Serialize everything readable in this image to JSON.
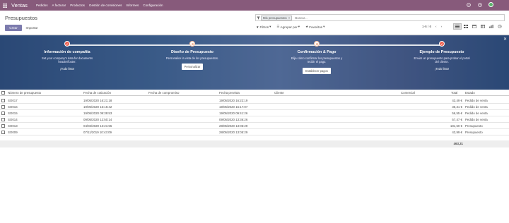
{
  "navbar": {
    "app_title": "Ventas",
    "menu": [
      "Pedidos",
      "A facturar",
      "Productos",
      "Gestión de comisiones",
      "Informes",
      "Configuración"
    ]
  },
  "control_panel": {
    "breadcrumb": "Presupuestos",
    "create_label": "Crear",
    "import_label": "Importar",
    "search_facet": "Mis presupuestos",
    "search_placeholder": "Buscar...",
    "filters_label": "Filtros",
    "group_label": "Agrupar por",
    "favorites_label": "Favoritos",
    "pager": "1-6 / 6"
  },
  "banner": {
    "steps": [
      {
        "title": "Información de compañía",
        "desc": "Set your company's data for documents header/footer.",
        "done": "¡Todo listo!",
        "button": "",
        "state": "done"
      },
      {
        "title": "Diseño de Presupuesto",
        "desc": "Personalice la vista de los presupuestos.",
        "done": "",
        "button": "Personalizar",
        "state": "todo"
      },
      {
        "title": "Confirmación & Pago",
        "desc": "Elija cómo confirmar los presupuestos y recibir el pago.",
        "done": "",
        "button": "Establecer pagos",
        "state": "todo"
      },
      {
        "title": "Ejemplo de Presupuesto",
        "desc": "Enviar un presupuesto para probar el portal del cliente.",
        "done": "¡Todo listo!",
        "button": "",
        "state": "done"
      }
    ]
  },
  "table": {
    "headers": {
      "number": "Número de presupuesto",
      "quote_date": "Fecha de cotización",
      "commit_date": "Fecha de compromiso",
      "expected_date": "Fecha prevista",
      "customer": "Cliente",
      "salesperson": "Comercial",
      "total": "Total",
      "status": "Estado"
    },
    "rows": [
      {
        "number": "SO017",
        "quote_date": "19/05/2020 16:21:18",
        "expected_date": "19/05/2020 16:22:19",
        "total": "43,49 €",
        "status": "Pedido de venta"
      },
      {
        "number": "SO016",
        "quote_date": "19/05/2020 16:16:42",
        "expected_date": "19/05/2020 16:17:07",
        "total": "36,31 €",
        "status": "Pedido de venta"
      },
      {
        "number": "SO015",
        "quote_date": "19/05/2020 09:39:53",
        "expected_date": "19/05/2020 09:41:26",
        "total": "56,55 €",
        "status": "Pedido de venta"
      },
      {
        "number": "SO014",
        "quote_date": "09/05/2020 12:50:14",
        "expected_date": "09/05/2020 13:36:26",
        "total": "57,47 €",
        "status": "Pedido de venta"
      },
      {
        "number": "SO013",
        "quote_date": "04/03/2020 13:21:55",
        "expected_date": "28/05/2020 13:05:29",
        "total": "181,50 €",
        "status": "Presupuesto"
      },
      {
        "number": "SO009",
        "quote_date": "07/11/2019 10:43:09",
        "expected_date": "28/05/2020 13:05:29",
        "total": "43,99 €",
        "status": "Presupuesto"
      }
    ],
    "sum_total": "463,31"
  },
  "colors": {
    "navbar": "#875a7b",
    "primary_button": "#7c7bad",
    "step_done": "#f06050"
  }
}
